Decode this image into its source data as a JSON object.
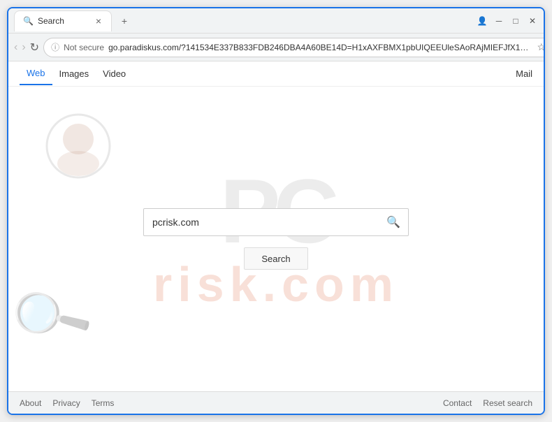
{
  "browser": {
    "tab_title": "Search",
    "tab_close": "×",
    "new_tab": "+",
    "window_controls": {
      "profile_icon": "👤",
      "minimize": "─",
      "maximize": "□",
      "close": "✕"
    },
    "nav": {
      "back": "‹",
      "forward": "›",
      "refresh": "↻",
      "security_label": "Not secure",
      "address": "go.paradiskus.com/?141534E337B833FDB246DBA4A60BE14D=H1xAXFBMX1pbUIQEEUleSAoRAjMIEFJfX1hHX1...",
      "star": "☆",
      "menu": "⋮"
    }
  },
  "site_nav": {
    "items": [
      {
        "label": "Web",
        "active": true
      },
      {
        "label": "Images",
        "active": false
      },
      {
        "label": "Video",
        "active": false
      }
    ],
    "mail_label": "Mail"
  },
  "search": {
    "input_value": "pcrisk.com",
    "input_placeholder": "",
    "button_label": "Search",
    "search_icon": "🔍"
  },
  "watermark": {
    "pc_text": "PC",
    "risk_text": "risk.com"
  },
  "footer": {
    "left_links": [
      {
        "label": "About"
      },
      {
        "label": "Privacy"
      },
      {
        "label": "Terms"
      }
    ],
    "right_links": [
      {
        "label": "Contact"
      },
      {
        "label": "Reset search"
      }
    ]
  }
}
